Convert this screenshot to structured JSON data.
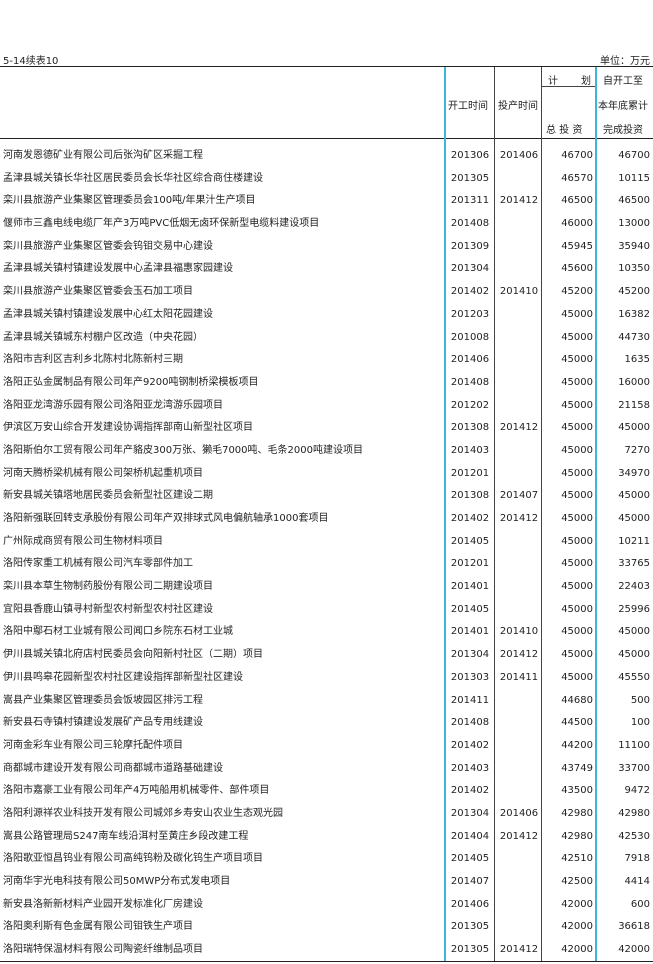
{
  "header": {
    "page_label": "5-14续表10",
    "unit": "单位：万元",
    "col_start": "开工时间",
    "col_prod": "投产时间",
    "col_plan_top_1": "计",
    "col_plan_top_2": "划",
    "col_plan_sub": "总 投 资",
    "col_done_1": "自开工至",
    "col_done_2": "本年底累计",
    "col_done_3": "完成投资"
  },
  "rows": [
    {
      "name": "河南发恩德矿业有限公司后张沟矿区采掘工程",
      "start": "201306",
      "prod": "201406",
      "total": "46700",
      "done": "46700"
    },
    {
      "name": "孟津县城关镇长华社区居民委员会长华社区综合商住楼建设",
      "start": "201305",
      "prod": "",
      "total": "46570",
      "done": "10115"
    },
    {
      "name": "栾川县旅游产业集聚区管理委员会100吨/年果汁生产项目",
      "start": "201311",
      "prod": "201412",
      "total": "46500",
      "done": "46500"
    },
    {
      "name": "偃师市三鑫电线电缆厂年产3万吨PVC低烟无卤环保新型电缆料建设项目",
      "start": "201408",
      "prod": "",
      "total": "46000",
      "done": "13000"
    },
    {
      "name": "栾川县旅游产业集聚区管委会钨钼交易中心建设",
      "start": "201309",
      "prod": "",
      "total": "45945",
      "done": "35940"
    },
    {
      "name": "孟津县城关镇村镇建设发展中心孟津县福惠家园建设",
      "start": "201304",
      "prod": "",
      "total": "45600",
      "done": "10350"
    },
    {
      "name": "栾川县旅游产业集聚区管委会玉石加工项目",
      "start": "201402",
      "prod": "201410",
      "total": "45200",
      "done": "45200"
    },
    {
      "name": "孟津县城关镇村镇建设发展中心红太阳花园建设",
      "start": "201203",
      "prod": "",
      "total": "45000",
      "done": "16382"
    },
    {
      "name": "孟津县城关镇城东村棚户区改造（中央花园）",
      "start": "201008",
      "prod": "",
      "total": "45000",
      "done": "44730"
    },
    {
      "name": "洛阳市吉利区吉利乡北陈村北陈新村三期",
      "start": "201406",
      "prod": "",
      "total": "45000",
      "done": "1635"
    },
    {
      "name": "洛阳正弘金属制品有限公司年产9200吨钢制桥梁模板项目",
      "start": "201408",
      "prod": "",
      "total": "45000",
      "done": "16000"
    },
    {
      "name": "洛阳亚龙湾游乐园有限公司洛阳亚龙湾游乐园项目",
      "start": "201202",
      "prod": "",
      "total": "45000",
      "done": "21158"
    },
    {
      "name": "伊滨区万安山综合开发建设协调指挥部南山新型社区项目",
      "start": "201308",
      "prod": "201412",
      "total": "45000",
      "done": "45000"
    },
    {
      "name": "洛阳斯伯尔工贸有限公司年产貉皮300万张、獭毛7000吨、毛条2000吨建设项目",
      "start": "201403",
      "prod": "",
      "total": "45000",
      "done": "7270"
    },
    {
      "name": "河南天腾桥梁机械有限公司架桥机起重机项目",
      "start": "201201",
      "prod": "",
      "total": "45000",
      "done": "34970"
    },
    {
      "name": "新安县城关镇塔地居民委员会新型社区建设二期",
      "start": "201308",
      "prod": "201407",
      "total": "45000",
      "done": "45000"
    },
    {
      "name": "洛阳新强联回转支承股份有限公司年产双排球式风电偏航轴承1000套项目",
      "start": "201402",
      "prod": "201412",
      "total": "45000",
      "done": "45000"
    },
    {
      "name": "广州际成商贸有限公司生物材料项目",
      "start": "201405",
      "prod": "",
      "total": "45000",
      "done": "10211"
    },
    {
      "name": "洛阳传家重工机械有限公司汽车零部件加工",
      "start": "201201",
      "prod": "",
      "total": "45000",
      "done": "33765"
    },
    {
      "name": "栾川县本草生物制药股份有限公司二期建设项目",
      "start": "201401",
      "prod": "",
      "total": "45000",
      "done": "22403"
    },
    {
      "name": "宜阳县香鹿山镇寻村新型农村新型农村社区建设",
      "start": "201405",
      "prod": "",
      "total": "45000",
      "done": "25996"
    },
    {
      "name": "洛阳中鄢石材工业城有限公司闻口乡院东石材工业城",
      "start": "201401",
      "prod": "201410",
      "total": "45000",
      "done": "45000"
    },
    {
      "name": "伊川县城关镇北府店村民委员会向阳新村社区（二期）项目",
      "start": "201304",
      "prod": "201412",
      "total": "45000",
      "done": "45000"
    },
    {
      "name": "伊川县鸣皋花园新型农村社区建设指挥部新型社区建设",
      "start": "201303",
      "prod": "201411",
      "total": "45000",
      "done": "45550"
    },
    {
      "name": "嵩县产业集聚区管理委员会饭坡园区排污工程",
      "start": "201411",
      "prod": "",
      "total": "44680",
      "done": "500"
    },
    {
      "name": "新安县石寺镇村镇建设发展矿产品专用线建设",
      "start": "201408",
      "prod": "",
      "total": "44500",
      "done": "100"
    },
    {
      "name": "河南金彩车业有限公司三轮摩托配件项目",
      "start": "201402",
      "prod": "",
      "total": "44200",
      "done": "11100"
    },
    {
      "name": "商都城市建设开发有限公司商都城市道路基础建设",
      "start": "201403",
      "prod": "",
      "total": "43749",
      "done": "33700"
    },
    {
      "name": "洛阳市嘉豪工业有限公司年产4万吨船用机械零件、部件项目",
      "start": "201402",
      "prod": "",
      "total": "43500",
      "done": "9472"
    },
    {
      "name": "洛阳利源祥农业科技开发有限公司城郊乡寿安山农业生态观光园",
      "start": "201304",
      "prod": "201406",
      "total": "42980",
      "done": "42980"
    },
    {
      "name": "嵩县公路管理局S247南车线沿洱村至黄庄乡段改建工程",
      "start": "201404",
      "prod": "201412",
      "total": "42980",
      "done": "42530"
    },
    {
      "name": "洛阳歌亚恒昌钨业有限公司高纯钨粉及碳化钨生产项目项目",
      "start": "201405",
      "prod": "",
      "total": "42510",
      "done": "7918"
    },
    {
      "name": "河南华宇光电科技有限公司50MWP分布式发电项目",
      "start": "201407",
      "prod": "",
      "total": "42500",
      "done": "4414"
    },
    {
      "name": "新安县洛新新材料产业园开发标准化厂房建设",
      "start": "201406",
      "prod": "",
      "total": "42000",
      "done": "600"
    },
    {
      "name": "洛阳奥利斯有色金属有限公司钼铁生产项目",
      "start": "201305",
      "prod": "",
      "total": "42000",
      "done": "36618"
    },
    {
      "name": "洛阳瑞特保温材料有限公司陶瓷纤维制品项目",
      "start": "201305",
      "prod": "201412",
      "total": "42000",
      "done": "42000"
    }
  ]
}
